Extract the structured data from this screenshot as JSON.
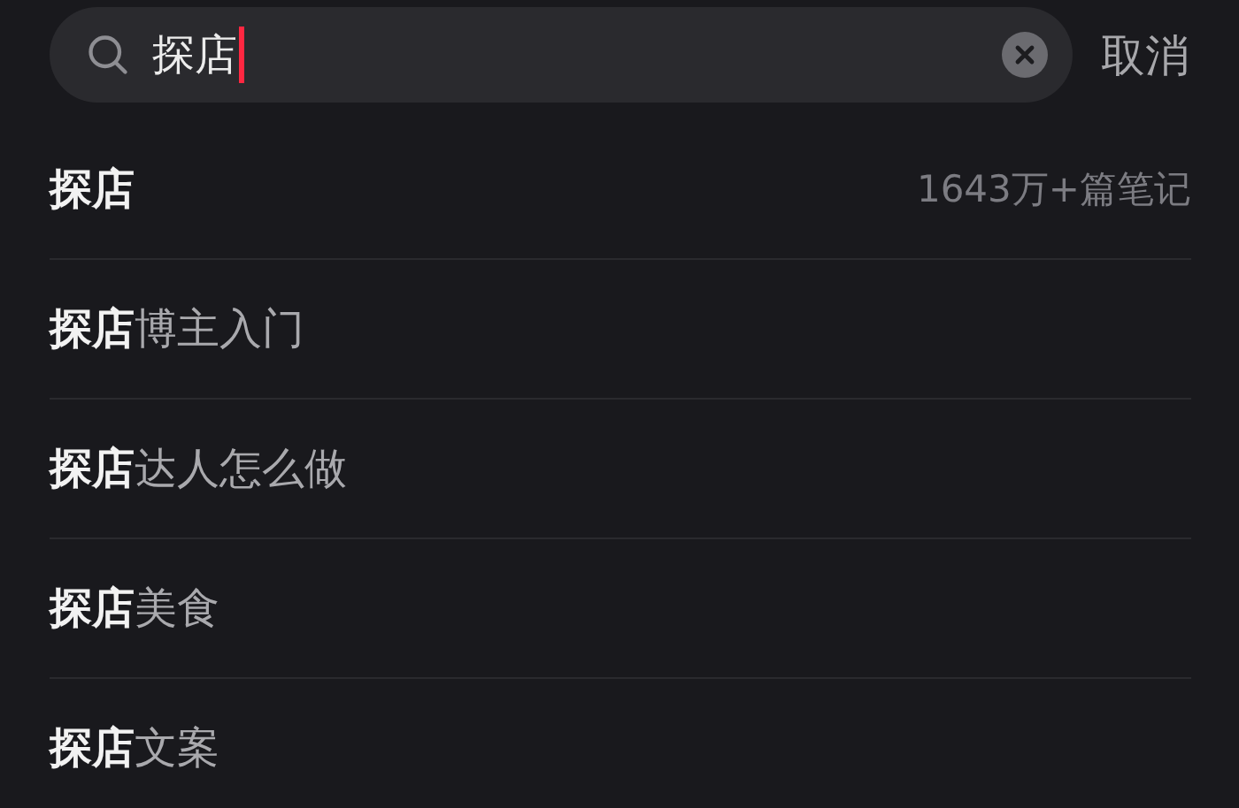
{
  "search": {
    "value": "探店",
    "focused": true,
    "cancel": "取消"
  },
  "suggestions": [
    {
      "kind": "exact",
      "text": "探店",
      "count": "1643万+篇笔记"
    },
    {
      "kind": "completion",
      "text": "**探店**博主入门"
    },
    {
      "kind": "completion",
      "text": "**探店**达人怎么做"
    },
    {
      "kind": "completion",
      "text": "**探店**美食"
    },
    {
      "kind": "completion",
      "text": "**探店**文案"
    }
  ]
}
